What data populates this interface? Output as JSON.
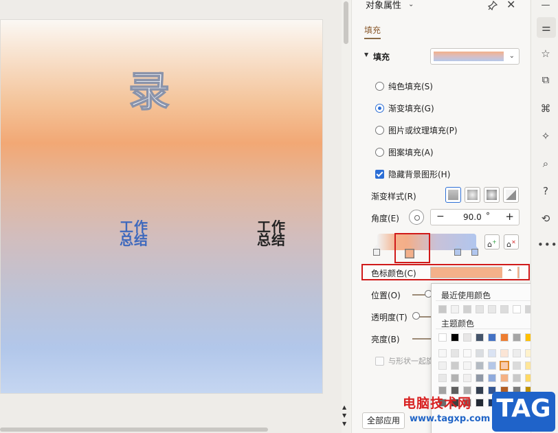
{
  "slide": {
    "char": "录",
    "title_blue": "工作总结",
    "title_dark": "工作总结"
  },
  "pane": {
    "title": "对象属性",
    "tab": "填充",
    "section": "填充",
    "fill_options": [
      {
        "label": "纯色填充(S)",
        "selected": false
      },
      {
        "label": "渐变填充(G)",
        "selected": true
      },
      {
        "label": "图片或纹理填充(P)",
        "selected": false
      },
      {
        "label": "图案填充(A)",
        "selected": false
      }
    ],
    "hide_bg_label": "隐藏背景图形(H)",
    "gradient_style_label": "渐变样式(R)",
    "angle_label": "角度(E)",
    "angle_value": "90.0",
    "angle_unit": "°",
    "stop_color_label": "色标颜色(C)",
    "stop_color": "#F4B18A",
    "position_label": "位置(O)",
    "transparency_label": "透明度(T)",
    "brightness_label": "亮度(B)",
    "rotate_with_shape_label": "与形状一起旋",
    "apply_all_label": "全部应用"
  },
  "color_popup": {
    "recent_heading": "最近使用颜色",
    "theme_heading": "主题颜色",
    "recent_colors": [
      "#c8c8c8",
      "#f2f2f2",
      "#d0d0d0",
      "#e4e4e4",
      "#e8e8e8",
      "#dcdcdc",
      "#ffffff",
      "#d4d4d4",
      "#3d8c86"
    ],
    "theme_colors": [
      "#ffffff",
      "#000000",
      "#e7e6e6",
      "#44546a",
      "#4472c4",
      "#ed7d31",
      "#a5a5a5",
      "#ffc000",
      "#5b9bd5",
      "#70ad47"
    ]
  },
  "watermark": {
    "text": "电脑技术网",
    "url": "www.tagxp.com",
    "logo": "TAG"
  }
}
